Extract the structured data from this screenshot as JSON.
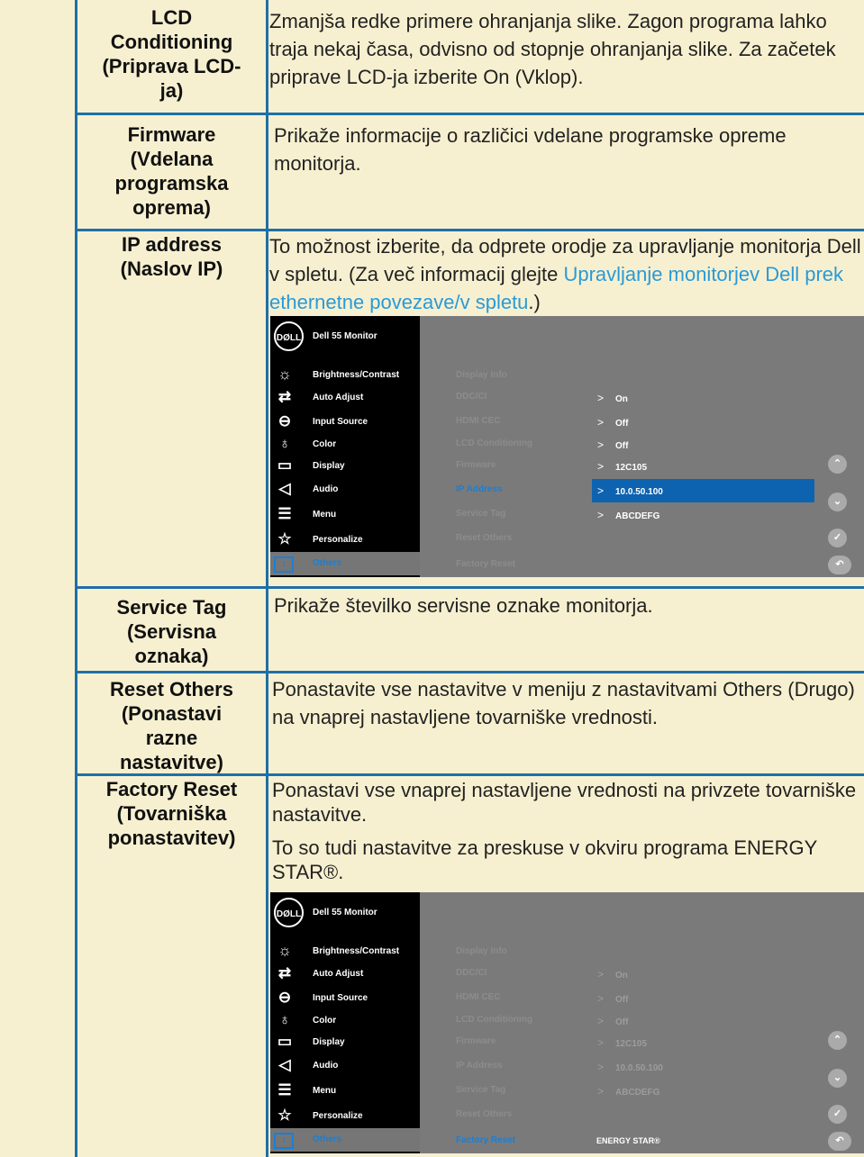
{
  "rows": [
    {
      "label_lines": [
        "LCD",
        "Conditioning",
        "(Priprava LCD-",
        "ja)"
      ],
      "desc": "Zmanjša redke primere ohranjanja slike. Zagon programa lahko traja nekaj časa, odvisno od stopnje ohranjanja slike. Za začetek priprave LCD-ja izberite On (Vklop)."
    },
    {
      "label_lines": [
        "Firmware",
        "(Vdelana",
        "programska",
        "oprema)"
      ],
      "desc": "Prikaže informacije o različici vdelane programske opreme monitorja."
    },
    {
      "label_lines": [
        "IP address",
        "(Naslov IP)"
      ],
      "desc_pre": "To možnost izberite, da odprete orodje za upravljanje monitorja Dell v spletu. (Za več informacij glejte ",
      "desc_link": "Upravljanje monitorjev Dell prek ethernetne povezave/v spletu",
      "desc_post": ".)"
    },
    {
      "label_lines": [
        "Service Tag",
        "(Servisna",
        "oznaka)"
      ],
      "desc": "Prikaže številko servisne oznake monitorja."
    },
    {
      "label_lines": [
        "Reset Others",
        "(Ponastavi",
        "razne",
        "nastavitve)"
      ],
      "desc": "Ponastavite vse nastavitve v meniju z nastavitvami Others (Drugo) na vnaprej nastavljene tovarniške vrednosti."
    },
    {
      "label_lines": [
        "Factory Reset",
        "(Tovarniška",
        "ponastavitev)"
      ],
      "desc_p1": "Ponastavi vse vnaprej nastavljene vrednosti na privzete tovarniške nastavitve.",
      "desc_p2": "To so tudi nastavitve za preskuse v okviru programa ENERGY STAR®."
    }
  ],
  "osd": {
    "logo": "DØLL",
    "title": "Dell 55 Monitor",
    "menu": [
      {
        "icon": "sun-icon",
        "glyph": "☼",
        "label": "Brightness/Contrast"
      },
      {
        "icon": "arrows-icon",
        "glyph": "⇄",
        "label": "Auto Adjust"
      },
      {
        "icon": "input-icon",
        "glyph": "⊖",
        "label": "Input Source"
      },
      {
        "icon": "palette-icon",
        "glyph": "♁",
        "label": "Color"
      },
      {
        "icon": "monitor-icon",
        "glyph": "▭",
        "label": "Display"
      },
      {
        "icon": "speaker-icon",
        "glyph": "◁",
        "label": "Audio"
      },
      {
        "icon": "menu-icon",
        "glyph": "☰",
        "label": "Menu"
      },
      {
        "icon": "star-icon",
        "glyph": "☆",
        "label": "Personalize"
      },
      {
        "icon": "others-icon",
        "glyph": "↕",
        "label": "Others"
      }
    ],
    "submenu": [
      "Display Info",
      "DDC/CI",
      "HDMI CEC",
      "LCD Conditioning",
      "Firmware",
      "IP Address",
      "Service Tag",
      "Reset Others",
      "Factory Reset"
    ],
    "values": [
      "On",
      "Off",
      "Off",
      "12C105",
      "10.0.50.100",
      "ABCDEFG"
    ],
    "energy_star": "ENERGY STAR®",
    "buttons": {
      "up": "⌃",
      "down": "⌄",
      "ok": "✓",
      "back": "↶"
    },
    "colors": {
      "panel": "#000000",
      "background": "#7a7a7a",
      "highlight": "#0e63b0",
      "accent": "#1a7fd6"
    }
  }
}
